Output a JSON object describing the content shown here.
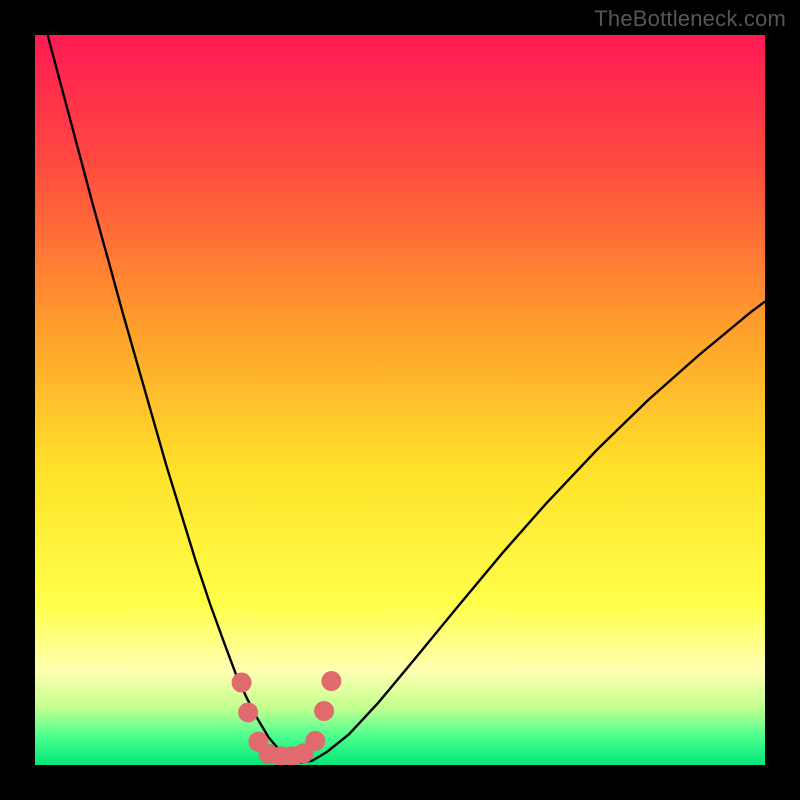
{
  "watermark": "TheBottleneck.com",
  "chart_data": {
    "type": "line",
    "title": "",
    "xlabel": "",
    "ylabel": "",
    "xlim": [
      0,
      100
    ],
    "ylim": [
      0,
      100
    ],
    "gradient_background": {
      "direction": "top-to-bottom",
      "stops": [
        {
          "pos": 0.0,
          "color": "#ff1a54"
        },
        {
          "pos": 0.18,
          "color": "#ff4b3f"
        },
        {
          "pos": 0.4,
          "color": "#ff9e2c"
        },
        {
          "pos": 0.6,
          "color": "#ffe22a"
        },
        {
          "pos": 0.78,
          "color": "#ffff4a"
        },
        {
          "pos": 0.87,
          "color": "#ffffb2"
        },
        {
          "pos": 0.92,
          "color": "#c6ff8f"
        },
        {
          "pos": 0.96,
          "color": "#4dff8f"
        },
        {
          "pos": 1.0,
          "color": "#00e878"
        }
      ]
    },
    "series": [
      {
        "name": "bottleneck-curve",
        "color": "#000000",
        "width": 2.4,
        "x": [
          0,
          2,
          4,
          6,
          8,
          10,
          12,
          14,
          16,
          18,
          20,
          22,
          24,
          26,
          27.5,
          29,
          30.5,
          32,
          33.5,
          35,
          36.5,
          38,
          40,
          43,
          47,
          52,
          58,
          64,
          70,
          77,
          84,
          91,
          98,
          100
        ],
        "y": [
          107,
          99,
          91.5,
          84,
          76.5,
          69.3,
          62,
          55,
          48,
          41,
          34.5,
          28,
          22,
          16.5,
          12.5,
          9.2,
          6.3,
          3.8,
          2.0,
          0.8,
          0.35,
          0.6,
          1.8,
          4.2,
          8.5,
          14.5,
          21.8,
          29.0,
          35.8,
          43.2,
          50.0,
          56.2,
          62.0,
          63.5
        ]
      },
      {
        "name": "marker-dots",
        "color": "#e06a6e",
        "type": "scatter",
        "radius": 10,
        "x": [
          28.3,
          29.2,
          30.6,
          32.0,
          33.7,
          35.3,
          36.8,
          38.4,
          39.6,
          40.6
        ],
        "y": [
          11.3,
          7.2,
          3.2,
          1.5,
          1.2,
          1.2,
          1.6,
          3.3,
          7.4,
          11.5
        ]
      }
    ]
  }
}
